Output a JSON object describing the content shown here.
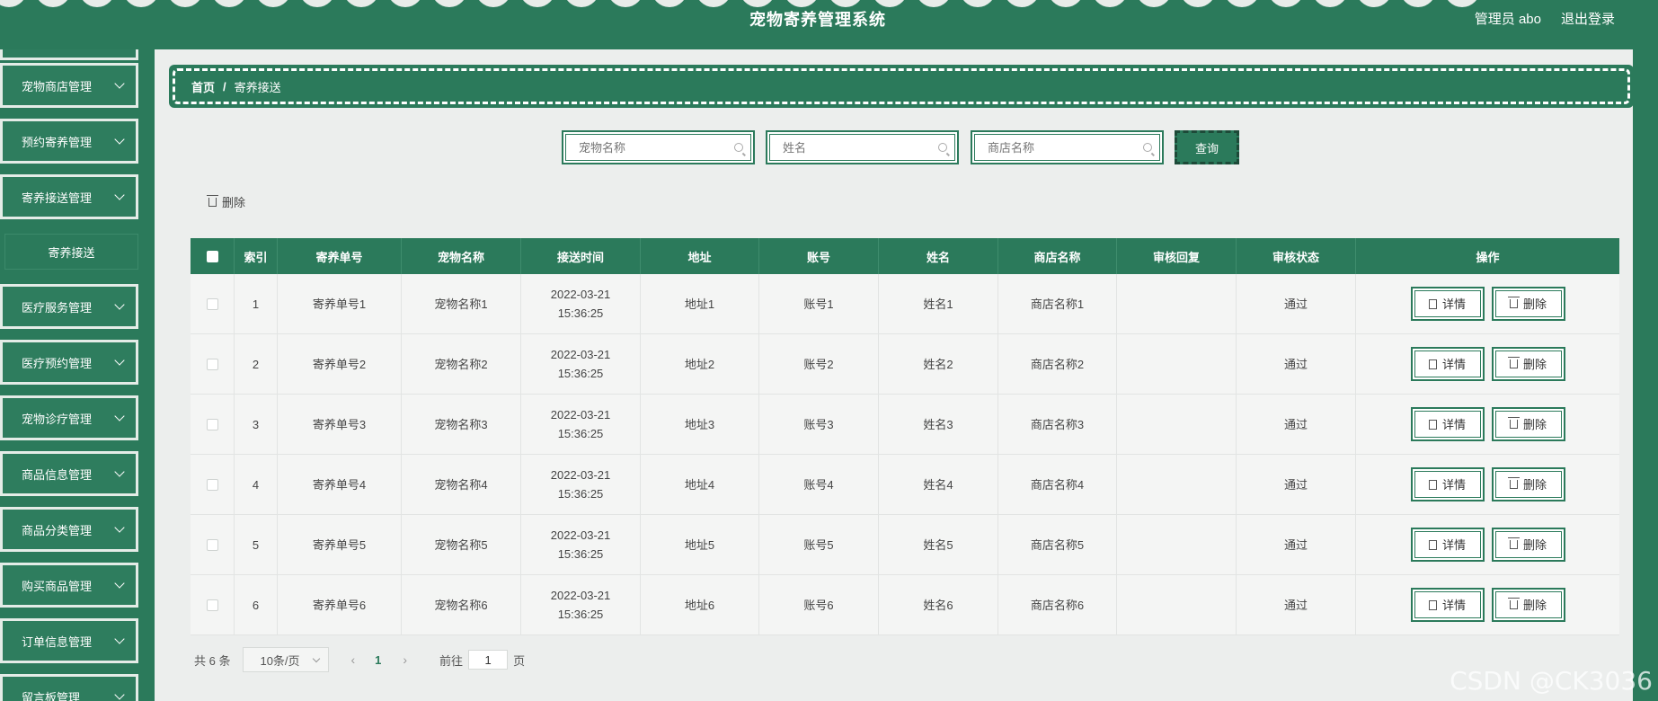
{
  "header": {
    "title": "宠物寄养管理系统",
    "user": "管理员 abo",
    "logout": "退出登录"
  },
  "sidebar": {
    "items": [
      {
        "label": "宠物商店管理"
      },
      {
        "label": "预约寄养管理"
      },
      {
        "label": "寄养接送管理"
      },
      {
        "label": "医疗服务管理"
      },
      {
        "label": "医疗预约管理"
      },
      {
        "label": "宠物诊疗管理"
      },
      {
        "label": "商品信息管理"
      },
      {
        "label": "商品分类管理"
      },
      {
        "label": "购买商品管理"
      },
      {
        "label": "订单信息管理"
      },
      {
        "label": "留言板管理"
      }
    ],
    "sub_item": "寄养接送"
  },
  "breadcrumb": {
    "home": "首页",
    "separator": "/",
    "current": "寄养接送"
  },
  "search": {
    "pet_name_placeholder": "宠物名称",
    "name_placeholder": "姓名",
    "shop_name_placeholder": "商店名称",
    "query_label": "查询"
  },
  "toolbar": {
    "delete_label": "删除"
  },
  "table": {
    "columns": [
      "索引",
      "寄养单号",
      "宠物名称",
      "接送时间",
      "地址",
      "账号",
      "姓名",
      "商店名称",
      "审核回复",
      "审核状态",
      "操作"
    ],
    "rows": [
      {
        "index": "1",
        "order": "寄养单号1",
        "pet": "宠物名称1",
        "time": "2022-03-21 15:36:25",
        "address": "地址1",
        "account": "账号1",
        "name": "姓名1",
        "shop": "商店名称1",
        "reply": "",
        "status": "通过"
      },
      {
        "index": "2",
        "order": "寄养单号2",
        "pet": "宠物名称2",
        "time": "2022-03-21 15:36:25",
        "address": "地址2",
        "account": "账号2",
        "name": "姓名2",
        "shop": "商店名称2",
        "reply": "",
        "status": "通过"
      },
      {
        "index": "3",
        "order": "寄养单号3",
        "pet": "宠物名称3",
        "time": "2022-03-21 15:36:25",
        "address": "地址3",
        "account": "账号3",
        "name": "姓名3",
        "shop": "商店名称3",
        "reply": "",
        "status": "通过"
      },
      {
        "index": "4",
        "order": "寄养单号4",
        "pet": "宠物名称4",
        "time": "2022-03-21 15:36:25",
        "address": "地址4",
        "account": "账号4",
        "name": "姓名4",
        "shop": "商店名称4",
        "reply": "",
        "status": "通过"
      },
      {
        "index": "5",
        "order": "寄养单号5",
        "pet": "宠物名称5",
        "time": "2022-03-21 15:36:25",
        "address": "地址5",
        "account": "账号5",
        "name": "姓名5",
        "shop": "商店名称5",
        "reply": "",
        "status": "通过"
      },
      {
        "index": "6",
        "order": "寄养单号6",
        "pet": "宠物名称6",
        "time": "2022-03-21 15:36:25",
        "address": "地址6",
        "account": "账号6",
        "name": "姓名6",
        "shop": "商店名称6",
        "reply": "",
        "status": "通过"
      }
    ],
    "detail_label": "详情",
    "delete_label": "删除"
  },
  "pagination": {
    "total": "共 6 条",
    "page_size": "10条/页",
    "prev": "‹",
    "current_page": "1",
    "next": "›",
    "goto_label": "前往",
    "goto_value": "1",
    "unit": "页"
  },
  "watermark": "CSDN @CK3036",
  "colors": {
    "primary": "#2b7a5b",
    "background": "#eceeed"
  }
}
